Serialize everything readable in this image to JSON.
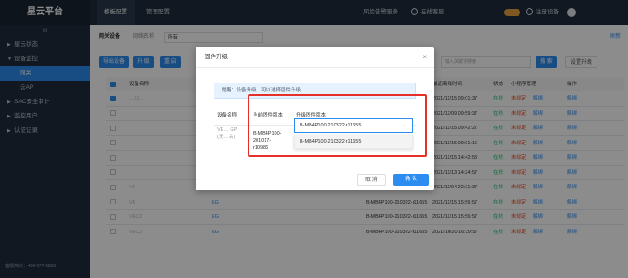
{
  "app": {
    "title": "星云平台"
  },
  "topnav": {
    "items": [
      "模板配置",
      "管理配置"
    ],
    "right": {
      "vas": "风险告警服务",
      "service": "在线客服",
      "register": "注册设备"
    }
  },
  "sidebar": {
    "collapse": "III",
    "items": [
      {
        "label": "星云状态",
        "arrow": "▶"
      },
      {
        "label": "设备监控",
        "arrow": "▼"
      },
      {
        "label": "网关",
        "sub": true
      },
      {
        "label": "云AP",
        "sub": true
      },
      {
        "label": "SAC安全审计",
        "arrow": "▶"
      },
      {
        "label": "监控用户",
        "arrow": "▶"
      },
      {
        "label": "认证记录",
        "arrow": "▶"
      }
    ],
    "footer": "客服热线：400-877-8865"
  },
  "filter": {
    "label": "网关设备",
    "group_label": "网络名称",
    "group_value": "所有",
    "advanced": "刷新"
  },
  "toolbar": {
    "buttons": [
      "导出设备",
      "升 级",
      "重 启"
    ],
    "search_placeholder": "输入关键字搜索",
    "search_btn": "搜 索",
    "upgrade_list": "设置升级"
  },
  "table": {
    "headers": [
      "设备名称",
      "最近离线时间",
      "状态",
      "小程序管理",
      "操作"
    ],
    "rows": [
      {
        "checked": true,
        "name": "…21…",
        "time": "2021/11/15 09:01:37",
        "status": "在线",
        "mini": "未绑定",
        "op": "解绑"
      },
      {
        "checked": false,
        "name": "",
        "time": "2021/11/09 09:59:37",
        "status": "在线",
        "mini": "未绑定",
        "op": "解绑"
      },
      {
        "checked": false,
        "name": "",
        "time": "2021/11/15 09:42:27",
        "status": "在线",
        "mini": "未绑定",
        "op": "解绑"
      },
      {
        "checked": false,
        "name": "",
        "time": "2021/11/15 09:01:16",
        "status": "在线",
        "mini": "未绑定",
        "op": "解绑"
      },
      {
        "checked": false,
        "name": "",
        "time": "2021/11/15 14:42:58",
        "status": "在线",
        "mini": "未绑定",
        "op": "解绑"
      },
      {
        "checked": false,
        "name": "",
        "time": "2021/11/13 14:24:57",
        "status": "在线",
        "mini": "未绑定",
        "op": "解绑"
      },
      {
        "checked": false,
        "name": "VE",
        "sn": "EG",
        "fw": "B-MB4P202-210021-r11656",
        "time": "2021/11/04 22:21:37",
        "status": "在线",
        "mini": "未绑定",
        "op": "解绑"
      },
      {
        "checked": false,
        "name": "VE",
        "sn": "EG",
        "fw": "B-MB4P100-210322-r11655",
        "time": "2021/11/15 15:56:57",
        "status": "在线",
        "mini": "未绑定",
        "op": "解绑"
      },
      {
        "checked": false,
        "name": "VEC2",
        "sn": "EG",
        "fw": "B-MB4P100-210322-r11655",
        "time": "2021/11/15 15:56:57",
        "status": "在线",
        "mini": "未绑定",
        "op": "解绑"
      },
      {
        "checked": false,
        "name": "VEC2",
        "sn": "EG",
        "fw": "B-MB4P100-210322-r11655",
        "time": "2021/10/20 16:29:57",
        "status": "在线",
        "mini": "未绑定",
        "op": "解绑"
      }
    ]
  },
  "modal": {
    "title": "固件升级",
    "tip": "提醒：设备升级，可以选择固件升级",
    "col_device": "设备名称",
    "col_current": "当前固件版本",
    "col_target": "升级固件版本",
    "device_name_1": "VE… GP",
    "device_name_2": "(无…名)",
    "current_fw_lines": [
      "B-MB4P100-",
      "201017-",
      "r10986"
    ],
    "selected_fw": "B-MB4P100-210322-r11655",
    "option": "B-MB4P100-210322-r11655",
    "cancel": "取 消",
    "confirm": "确 认",
    "close": "×"
  }
}
